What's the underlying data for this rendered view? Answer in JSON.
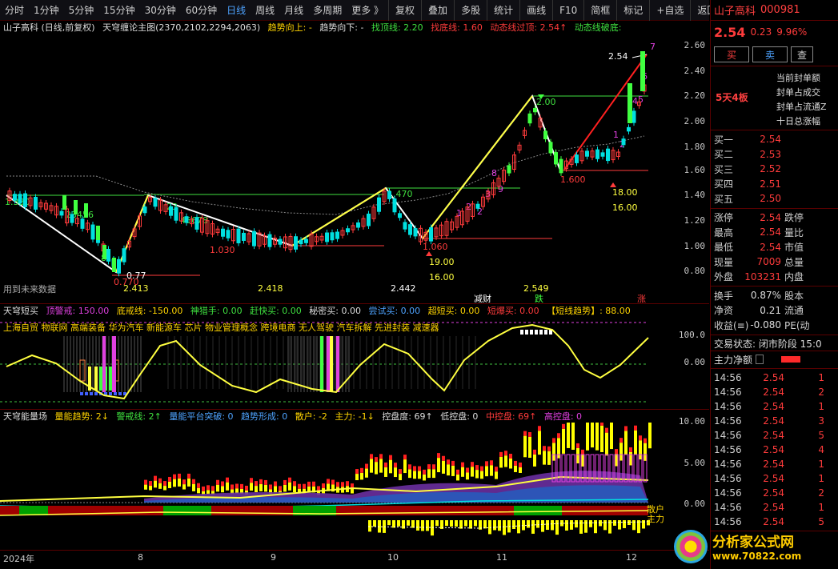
{
  "toolbar": {
    "periods": [
      "分时",
      "1分钟",
      "5分钟",
      "15分钟",
      "30分钟",
      "60分钟",
      "日线",
      "周线",
      "月线",
      "多周期",
      "更多 》"
    ],
    "active_period": "日线",
    "tools": [
      "复权",
      "叠加",
      "多股",
      "统计",
      "画线",
      "F10",
      "简框",
      "标记",
      "+自选",
      "返回"
    ]
  },
  "main_panel": {
    "title": "山子高科 (日线,前复权)",
    "indicator": "天穹缠论主图(2370,2102,2294,2063)",
    "trend_up": "趋势向上: -",
    "trend_down": "趋势向下: -",
    "find_top": "找顶线: 2.20",
    "find_bottom": "找底线: 1.60",
    "dyn_top": "动态线过顶: 2.54↑",
    "dyn_break": "动态线破底:",
    "y_ticks": [
      "2.60",
      "2.40",
      "2.20",
      "2.00",
      "1.80",
      "1.60",
      "1.40",
      "1.20",
      "1.00",
      "0.80"
    ],
    "note": "用到未来数据",
    "labels": {
      "p254": "2.54",
      "p200": "2.00",
      "p1600": "1.600",
      "p1800": "18.00",
      "p1600b": "16.00",
      "p1470": "1.470",
      "p1060": "1.060",
      "p1900": "19.00",
      "p1600c": "16.00",
      "p1030": "1.030",
      "p077": "0.77",
      "p077r": "0.770",
      "p1380": "1.380",
      "b1": "2.413",
      "b2": "2.418",
      "b3": "2.442",
      "b4": "2.549",
      "seq1": "23456",
      "seq2": "45678",
      "n8": "8",
      "n23": "23",
      "jiancai": "减财",
      "die": "跌",
      "zhang": "涨"
    }
  },
  "short_panel": {
    "title": "天穹短买",
    "top_alert": "顶警戒: 150.00",
    "bottom_line": "底戒线: -150.00",
    "shen": "神猎手: 0.00",
    "ganjin": "赶快买: 0.00",
    "mimi": "秘密买: 0.00",
    "changshi": "尝试买: 0.00",
    "chaohan": "超短买: 0.00",
    "duanbao": "短爆买: 0.00",
    "trend_label": "【短线趋势】: 88.00",
    "concepts": "上海自贸 物联网 高端装备 华为汽车 新能源车 芯片 物业管理概念 跨境电商 无人驾驶 汽车拆解 先进封装 减速器",
    "y_ticks": [
      "100.0",
      "0.00"
    ]
  },
  "volume_panel": {
    "title": "天穹能量场",
    "qn": "量能趋势: 2↓",
    "jj": "警戒线: 2↑",
    "pt": "量能平台突破: 0",
    "qs": "趋势形成: 0",
    "sh": "散户: -2",
    "zl": "主力: -1↓",
    "kp": "控盘度: 69↑",
    "dk": "低控盘: 0",
    "zk": "中控盘: 69↑",
    "gk": "高控盘: 0",
    "y_ticks": [
      "10.00",
      "5.00",
      "0.00"
    ],
    "side_labels": [
      "散户",
      "主力"
    ]
  },
  "x_axis": [
    "2024年",
    "8",
    "9",
    "10",
    "11",
    "12"
  ],
  "quote": {
    "name": "山子高科",
    "code": "000981",
    "price": "2.54",
    "change": "0.23",
    "pct": "9.96%",
    "buy": "买",
    "sell": "卖",
    "more": "查",
    "board": "5天4板",
    "seal_lines": [
      "当前封单额",
      "封单占成交",
      "封单占流通Z",
      "十日总涨幅"
    ],
    "bids": [
      {
        "k": "买一",
        "v": "2.54"
      },
      {
        "k": "买二",
        "v": "2.53"
      },
      {
        "k": "买三",
        "v": "2.52"
      },
      {
        "k": "买四",
        "v": "2.51"
      },
      {
        "k": "买五",
        "v": "2.50"
      }
    ],
    "stats": [
      {
        "k": "涨停",
        "v": "2.54",
        "k2": "跌停"
      },
      {
        "k": "最高",
        "v": "2.54",
        "k2": "量比"
      },
      {
        "k": "最低",
        "v": "2.54",
        "k2": "市值"
      },
      {
        "k": "现量",
        "v": "7009",
        "k2": "总量"
      },
      {
        "k": "外盘",
        "v": "103231",
        "k2": "内盘"
      }
    ],
    "stats2": [
      {
        "k": "换手",
        "v": "0.87%",
        "k2": "股本"
      },
      {
        "k": "净资",
        "v": "0.21",
        "k2": "流通"
      },
      {
        "k": "收益(≡)",
        "v": "-0.080",
        "k2": "PE(动"
      }
    ],
    "status": "交易状态: 闭市阶段 15:0",
    "net": "主力净额",
    "trades": [
      {
        "t": "14:56",
        "p": "2.54",
        "n": "1"
      },
      {
        "t": "14:56",
        "p": "2.54",
        "n": "2"
      },
      {
        "t": "14:56",
        "p": "2.54",
        "n": "1"
      },
      {
        "t": "14:56",
        "p": "2.54",
        "n": "3"
      },
      {
        "t": "14:56",
        "p": "2.54",
        "n": "5"
      },
      {
        "t": "14:56",
        "p": "2.54",
        "n": "4"
      },
      {
        "t": "14:56",
        "p": "2.54",
        "n": "1"
      },
      {
        "t": "14:56",
        "p": "2.54",
        "n": "1"
      },
      {
        "t": "14:56",
        "p": "2.54",
        "n": "2"
      },
      {
        "t": "14:56",
        "p": "2.54",
        "n": "1"
      },
      {
        "t": "14:56",
        "p": "2.54",
        "n": "5"
      }
    ]
  },
  "logo": {
    "title": "分析家公式网",
    "url": "www.70822.com"
  }
}
